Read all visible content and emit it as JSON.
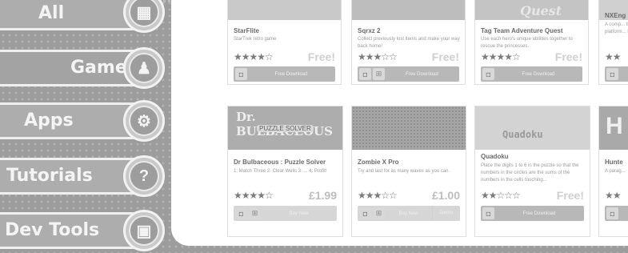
{
  "nav": [
    {
      "label": "All",
      "icon": "grid-icon",
      "glyph": "▦"
    },
    {
      "label": "Games",
      "icon": "joystick-icon",
      "glyph": "♟"
    },
    {
      "label": "Apps",
      "icon": "gears-icon",
      "glyph": "⚙"
    },
    {
      "label": "Tutorials",
      "icon": "question-icon",
      "glyph": "?"
    },
    {
      "label": "Dev Tools",
      "icon": "blocks-icon",
      "glyph": "▣"
    }
  ],
  "cards": [
    {
      "title": "StarFlite",
      "desc": "StarTrek retro game",
      "stars": "★★★★☆",
      "price": "Free!",
      "button": "Free Download"
    },
    {
      "title": "Sqrxz 2",
      "desc": "Collect previously lost items and make your way back home!",
      "stars": "★★★☆☆",
      "price": "Free!",
      "button": "Free Download"
    },
    {
      "title": "Tag Team Adventure Quest",
      "desc": "Use each hero's unique abilities together to rescue the princesses.",
      "stars": "★★★★☆",
      "price": "Free!",
      "button": "Free Download",
      "banner": "Quest"
    },
    {
      "title": "NXEng",
      "desc": "A comp... the ma... platform... known...",
      "stars": "★★",
      "price": "",
      "button": ""
    },
    {
      "title": "Dr Bulbaceous : Puzzle Solver",
      "desc": "1: Match Three 2: Clear Wells 3: ... 4: Profit!",
      "stars": "★★★★☆",
      "price": "£1.99",
      "button": "Buy Now",
      "banner_title": "Dr. BULBACEOUS",
      "banner_sub": "PUZZLE SOLVER"
    },
    {
      "title": "Zombie X Pro",
      "desc": "Try and last for as many waves as you can.",
      "stars": "★★★☆☆",
      "price": "£1.00",
      "button": "Buy Now",
      "demo": "Demo"
    },
    {
      "title": "Quadoku",
      "desc": "Place the digits 1 to 6 in the puzzle so that the numbers in the circles are the sums of the numbers in the cells touching...",
      "stars": "★★☆☆☆",
      "price": "Free!",
      "button": "Free Download",
      "banner": "Quadoku"
    },
    {
      "title": "Hunte",
      "desc": "A parag...",
      "stars": "★★",
      "price": "",
      "button": "",
      "banner": "H"
    }
  ]
}
